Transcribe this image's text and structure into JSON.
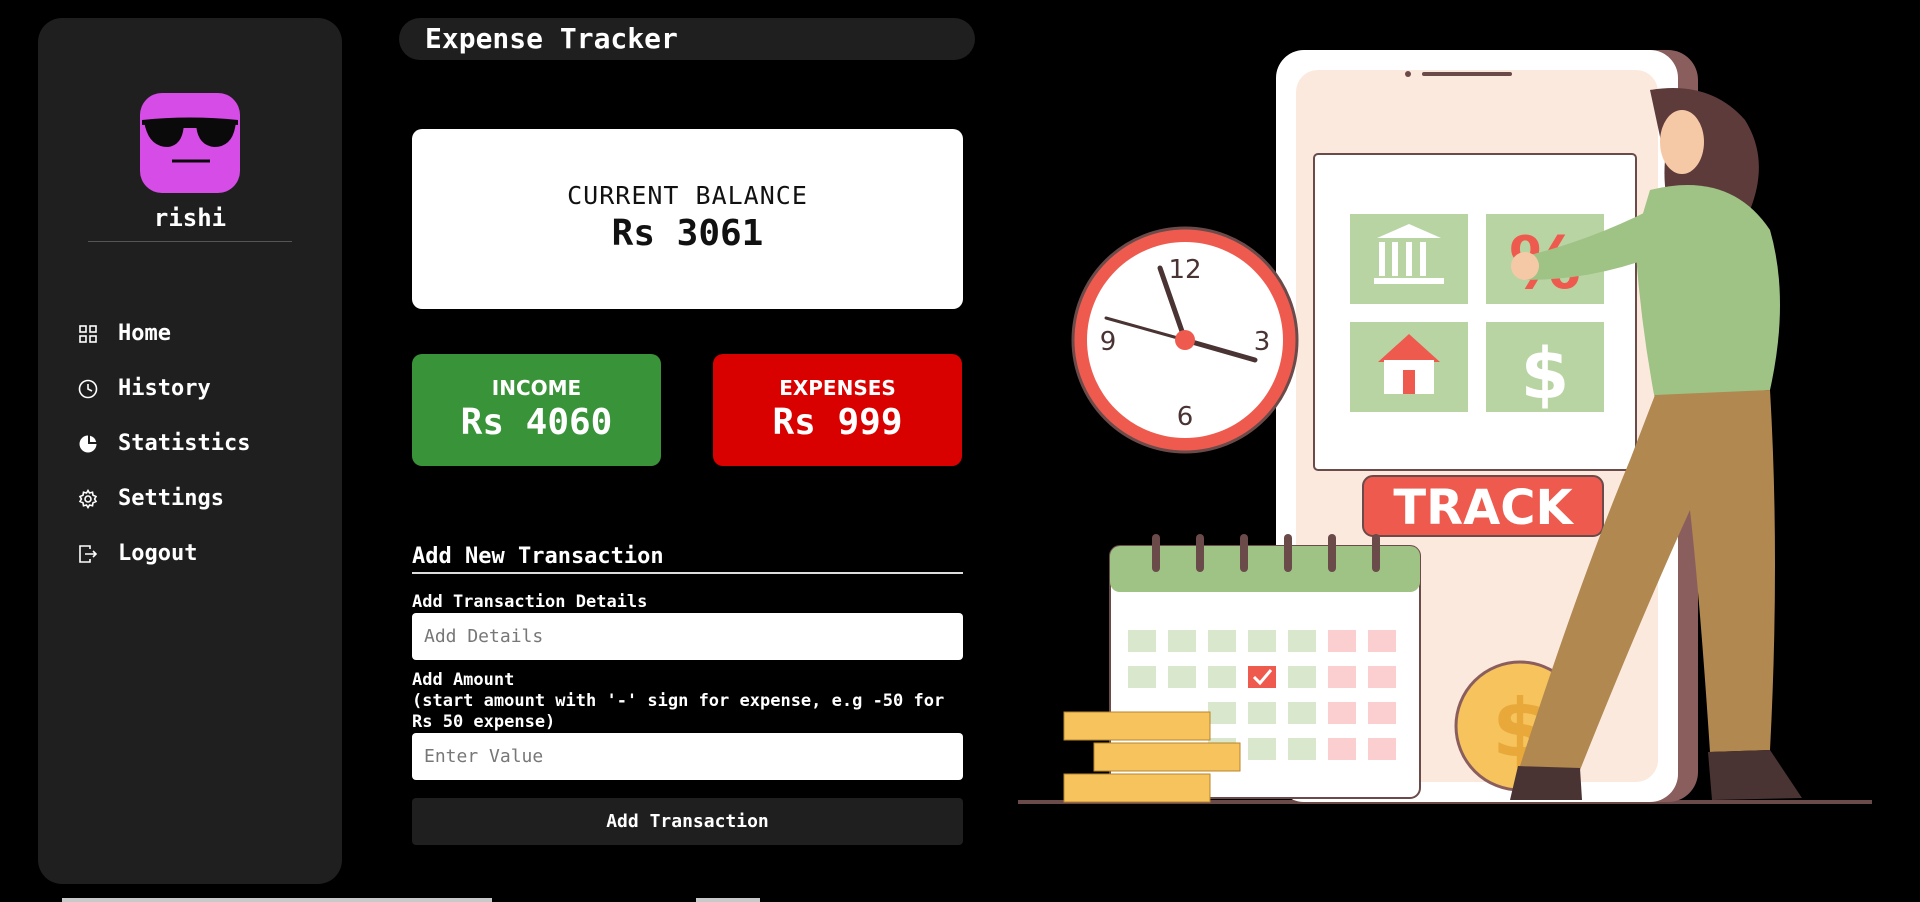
{
  "app": {
    "title": "Expense Tracker"
  },
  "sidebar": {
    "username": "rishi",
    "items": [
      {
        "label": "Home",
        "icon": "grid-icon"
      },
      {
        "label": "History",
        "icon": "clock-icon"
      },
      {
        "label": "Statistics",
        "icon": "pie-chart-icon"
      },
      {
        "label": "Settings",
        "icon": "gear-icon"
      },
      {
        "label": "Logout",
        "icon": "logout-icon"
      }
    ]
  },
  "balance": {
    "label": "CURRENT BALANCE",
    "value": "Rs 3061"
  },
  "income": {
    "label": "INCOME",
    "value": "Rs 4060"
  },
  "expenses": {
    "label": "EXPENSES",
    "value": "Rs 999"
  },
  "form": {
    "title": "Add New Transaction",
    "details_label": "Add Transaction Details",
    "details_placeholder": "Add Details",
    "amount_label": "Add Amount",
    "amount_hint": "(start amount with '-' sign for expense, e.g -50 for Rs 50 expense)",
    "amount_placeholder": "Enter Value",
    "submit_label": "Add Transaction"
  },
  "illustration": {
    "banner_text": "TRACK",
    "clock_numbers": [
      "12",
      "3",
      "6",
      "9"
    ]
  },
  "colors": {
    "income": "#399339",
    "expense": "#d90000",
    "avatar": "#d64ce6",
    "panel": "#1f1f1f"
  }
}
